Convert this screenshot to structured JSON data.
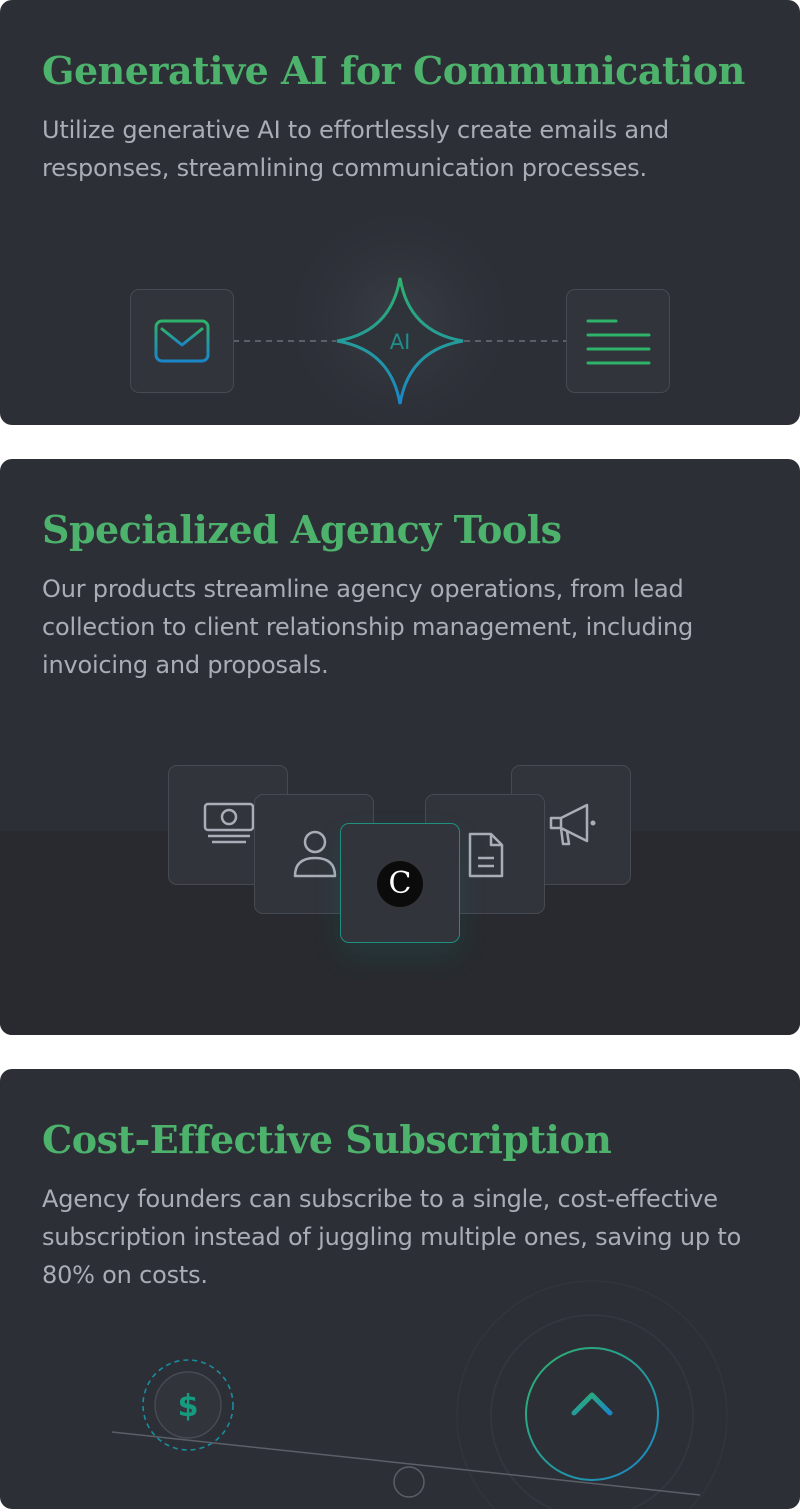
{
  "features": [
    {
      "title": "Generative AI for Communication",
      "description": "Utilize generative AI to effortlessly create emails and responses, streamlining communication processes.",
      "badge": "AI"
    },
    {
      "title": "Specialized Agency Tools",
      "description": "Our products streamline agency operations, from lead collection to client relationship management, including invoicing and proposals.",
      "brand_letter": "C"
    },
    {
      "title": "Cost-Effective Subscription",
      "description": "Agency founders can subscribe to a single, cost-effective subscription instead of juggling multiple ones, saving up to 80% on costs.",
      "currency_symbol": "$"
    }
  ],
  "icons": [
    "mail-icon",
    "ai-sparkle-icon",
    "text-lines-icon",
    "money-icon",
    "user-icon",
    "brand-icon",
    "document-icon",
    "megaphone-icon",
    "dollar-coin-icon",
    "arrow-up-icon"
  ],
  "colors": {
    "accent_green": "#4cb26c",
    "accent_teal": "#14a38b",
    "accent_blue": "#1a86c8",
    "card_bg": "#2c2f36",
    "text_muted": "#a9adb6"
  }
}
